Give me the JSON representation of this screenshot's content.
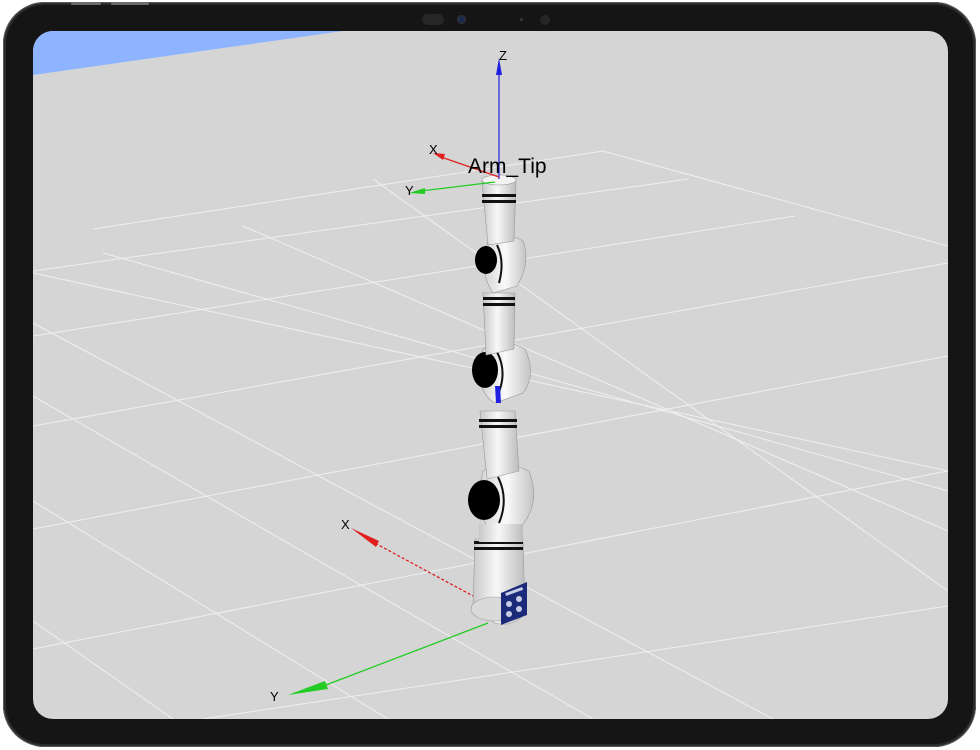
{
  "viewer": {
    "frame_label": "Arm_Tip",
    "tip_axes": {
      "x_label": "X",
      "y_label": "Y",
      "z_label": "Z"
    },
    "base_axes": {
      "x_label": "X",
      "y_label": "Y"
    }
  },
  "colors": {
    "x_axis": "#e02020",
    "y_axis": "#22cc22",
    "z_axis": "#2020e0",
    "ground": "#d5d5d5",
    "grid": "#f2f2f2",
    "sky": "#8fb4ff",
    "arm_body": "#ececec",
    "arm_ring": "#111111",
    "base_plate": "#1c2a7a"
  }
}
